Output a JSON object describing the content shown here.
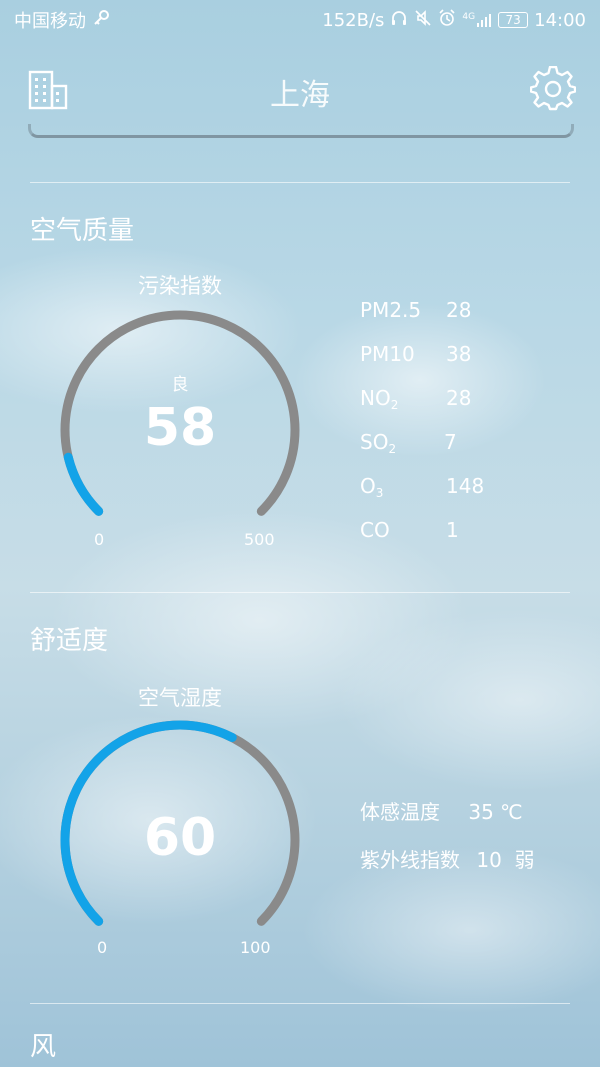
{
  "status_bar": {
    "carrier": "中国移动",
    "net_speed": "152B/s",
    "network": "4G",
    "battery": "73",
    "time": "14:00"
  },
  "header": {
    "title": "上海",
    "left_icon": "city-buildings-icon",
    "right_icon": "gear-icon"
  },
  "air_quality": {
    "section_title": "空气质量",
    "gauge": {
      "label": "污染指数",
      "status": "良",
      "value": "58",
      "min": "0",
      "max": "500",
      "fraction": 0.116
    },
    "pollutants": [
      {
        "name": "PM2.5",
        "sub": "",
        "value": "28"
      },
      {
        "name": "PM10",
        "sub": "",
        "value": "38"
      },
      {
        "name": "NO",
        "sub": "2",
        "value": "28"
      },
      {
        "name": "SO",
        "sub": "2",
        "value": "7"
      },
      {
        "name": "O",
        "sub": "3",
        "value": "148"
      },
      {
        "name": "CO",
        "sub": "",
        "value": "1"
      }
    ]
  },
  "comfort": {
    "section_title": "舒适度",
    "gauge": {
      "label": "空气湿度",
      "value": "60",
      "min": "0",
      "max": "100",
      "fraction": 0.6
    },
    "feels_like_label": "体感温度",
    "feels_like_value": "35 ℃",
    "uv_label": "紫外线指数",
    "uv_value": "10  弱"
  },
  "wind": {
    "section_title": "风"
  },
  "colors": {
    "gauge_track": "#8a8a8a",
    "gauge_fill": "#13a3e8"
  }
}
